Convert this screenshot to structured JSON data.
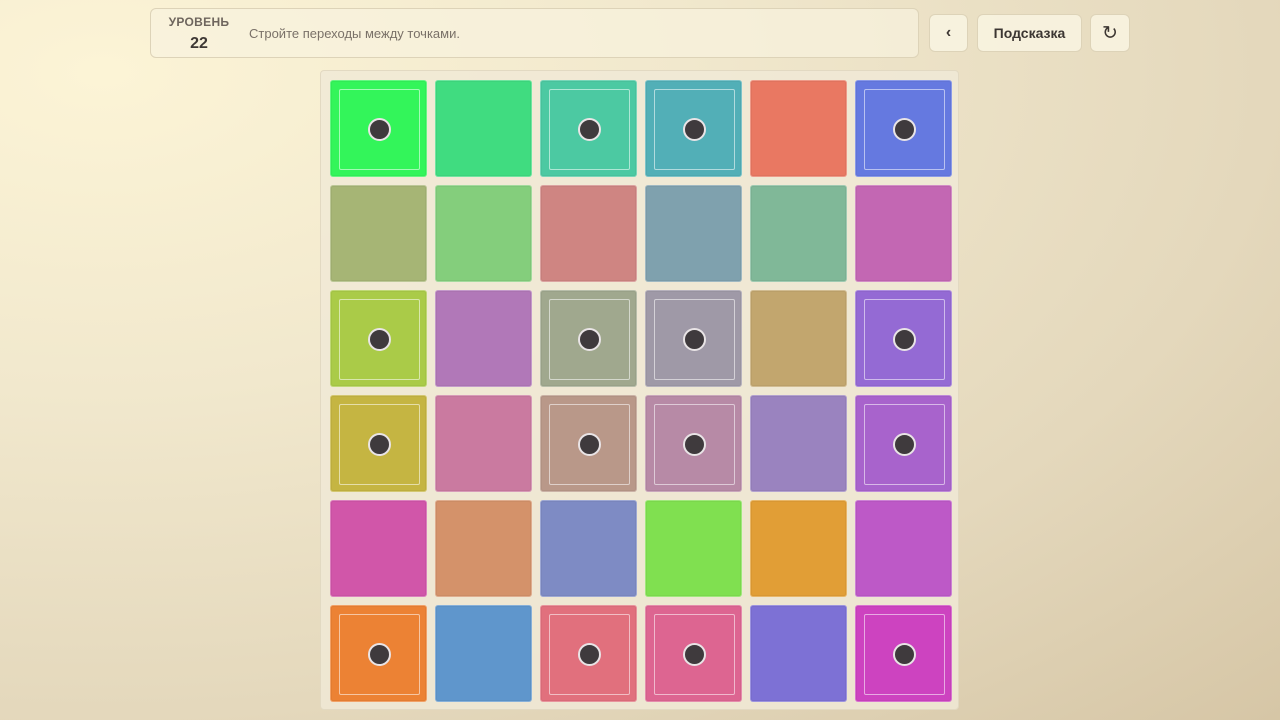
{
  "header": {
    "level_label": "УРОВЕНЬ",
    "level_number": "22",
    "instruction": "Стройте переходы между точками."
  },
  "buttons": {
    "back_label": "‹",
    "hint_label": "Подсказка",
    "restart_label": "↻"
  },
  "grid": {
    "rows": 6,
    "cols": 6,
    "tiles": [
      {
        "color": "#33f55a",
        "dot": true
      },
      {
        "color": "#40dc80",
        "dot": false
      },
      {
        "color": "#4cc9a2",
        "dot": true
      },
      {
        "color": "#52afb7",
        "dot": true
      },
      {
        "color": "#e97862",
        "dot": false
      },
      {
        "color": "#6579e0",
        "dot": true
      },
      {
        "color": "#a6b575",
        "dot": false
      },
      {
        "color": "#84ce7c",
        "dot": false
      },
      {
        "color": "#cf8582",
        "dot": false
      },
      {
        "color": "#7fa1ae",
        "dot": false
      },
      {
        "color": "#80b898",
        "dot": false
      },
      {
        "color": "#c367b3",
        "dot": false
      },
      {
        "color": "#aacb48",
        "dot": true
      },
      {
        "color": "#b178b8",
        "dot": false
      },
      {
        "color": "#a0a88e",
        "dot": true
      },
      {
        "color": "#9f99a7",
        "dot": true
      },
      {
        "color": "#c2a66e",
        "dot": false
      },
      {
        "color": "#946ad4",
        "dot": true
      },
      {
        "color": "#c5b542",
        "dot": true
      },
      {
        "color": "#ca7aa0",
        "dot": false
      },
      {
        "color": "#b99889",
        "dot": true
      },
      {
        "color": "#b78aa6",
        "dot": true
      },
      {
        "color": "#9a83bf",
        "dot": false
      },
      {
        "color": "#a863cc",
        "dot": true
      },
      {
        "color": "#d156a9",
        "dot": false
      },
      {
        "color": "#d4926a",
        "dot": false
      },
      {
        "color": "#7e8bc4",
        "dot": false
      },
      {
        "color": "#80e050",
        "dot": false
      },
      {
        "color": "#e19e36",
        "dot": false
      },
      {
        "color": "#bd59c7",
        "dot": false
      },
      {
        "color": "#ec8234",
        "dot": true
      },
      {
        "color": "#5f96cc",
        "dot": false
      },
      {
        "color": "#e1707d",
        "dot": true
      },
      {
        "color": "#dd6591",
        "dot": true
      },
      {
        "color": "#7d71d5",
        "dot": false
      },
      {
        "color": "#cd43c0",
        "dot": true
      }
    ]
  }
}
